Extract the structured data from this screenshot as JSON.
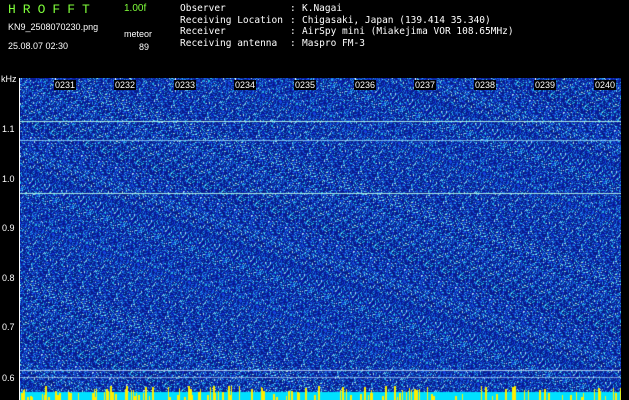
{
  "header": {
    "logo_text": "HROFFT",
    "version": "1.00f",
    "file_name": "KN9_2508070230.png",
    "datetime": "25.08.07 02:30",
    "meteor_label": "meteor",
    "meteor_count": "89"
  },
  "meta": [
    {
      "label": "Observer",
      "value": "K.Nagai"
    },
    {
      "label": "Receiving Location",
      "value": "Chigasaki, Japan (139.414 35.340)"
    },
    {
      "label": "Receiver",
      "value": "AirSpy mini (Miakejima VOR 108.65MHz)"
    },
    {
      "label": "Receiving antenna",
      "value": "Maspro FM-3"
    }
  ],
  "axis": {
    "unit": "kHz",
    "y_labels": [
      "1.1",
      "1.0",
      "0.9",
      "0.8",
      "0.7",
      "0.6"
    ],
    "x_labels": [
      "0231",
      "0232",
      "0233",
      "0234",
      "0235",
      "0236",
      "0237",
      "0238",
      "0239",
      "0240"
    ]
  },
  "colors": {
    "background": "#000000",
    "spectrum_base": "#0a1a9a",
    "noise_bright": "#7ad8ff",
    "line_signal": "#8fe0ff",
    "bottom_band": "#00e0ff",
    "bottom_spikes": "#ffee00",
    "logo": "#7fff3a"
  }
}
